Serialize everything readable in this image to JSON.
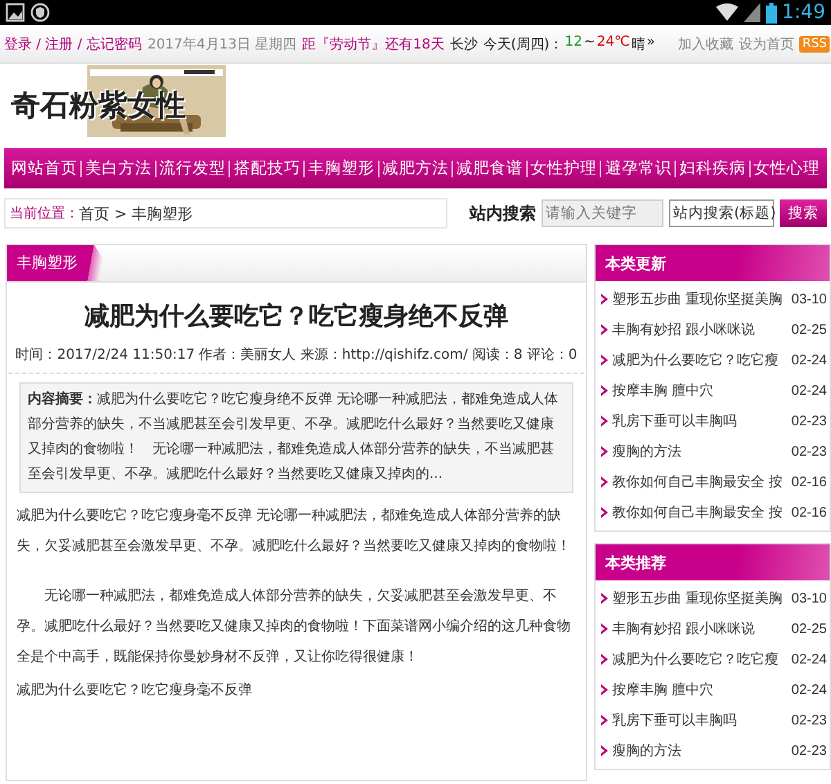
{
  "status_bar": {
    "time": "1:49"
  },
  "top_bar": {
    "account_links": "登录 / 注册 / 忘记密码",
    "date": "2017年4月13日 星期四",
    "countdown": "距『劳动节』还有18天",
    "city": "长沙",
    "weather_label": "今天(周四)：",
    "temp_low": "12",
    "temp_sep": "~",
    "temp_high": "24℃",
    "weather": "晴",
    "more": "»",
    "bookmark": "加入收藏",
    "homepage": "设为首页",
    "rss": "RSS"
  },
  "logo": {
    "text": "奇石粉紫女性"
  },
  "nav": [
    "网站首页",
    "美白方法",
    "流行发型",
    "搭配技巧",
    "丰胸塑形",
    "减肥方法",
    "减肥食谱",
    "女性护理",
    "避孕常识",
    "妇科疾病",
    "女性心理"
  ],
  "breadcrumb": {
    "label": "当前位置：",
    "path": "首页 > 丰胸塑形"
  },
  "search": {
    "label": "站内搜索",
    "placeholder": "请输入关键字",
    "scope": "站内搜索(标题)",
    "button": "搜索"
  },
  "article": {
    "section": "丰胸塑形",
    "title": "减肥为什么要吃它？吃它瘦身绝不反弹",
    "meta": "时间：2017/2/24 11:50:17  作者：美丽女人  来源：http://qishifz.com/  阅读：8  评论：0",
    "summary": "**内容摘要：**减肥为什么要吃它？吃它瘦身绝不反弹 无论哪一种减肥法，都难免造成人体部分营养的缺失，不当减肥甚至会引发早更、不孕。减肥吃什么最好？当然要吃又健康又掉肉的食物啦！　无论哪一种减肥法，都难免造成人体部分营养的缺失，不当减肥甚至会引发早更、不孕。减肥吃什么最好？当然要吃又健康又掉肉的...",
    "paragraphs": [
      "减肥为什么要吃它？吃它瘦身毫不反弹 无论哪一种减肥法，都难免造成人体部分营养的缺失，欠妥减肥甚至会激发早更、不孕。减肥吃什么最好？当然要吃又健康又掉肉的食物啦！",
      "　　无论哪一种减肥法，都难免造成人体部分营养的缺失，欠妥减肥甚至会激发早更、不孕。减肥吃什么最好？当然要吃又健康又掉肉的食物啦！下面菜谱网小编介绍的这几种食物全是个中高手，既能保持你曼妙身材不反弹，又让你吃得很健康！",
      "减肥为什么要吃它？吃它瘦身毫不反弹"
    ]
  },
  "sidebar": [
    {
      "title": "本类更新",
      "items": [
        {
          "text": "塑形五步曲 重现你坚挺美胸",
          "date": "03-10"
        },
        {
          "text": "丰胸有妙招 跟小咪咪说",
          "date": "02-25"
        },
        {
          "text": "减肥为什么要吃它？吃它瘦",
          "date": "02-24"
        },
        {
          "text": "按摩丰胸 膻中穴",
          "date": "02-24"
        },
        {
          "text": "乳房下垂可以丰胸吗",
          "date": "02-23"
        },
        {
          "text": "瘦胸的方法",
          "date": "02-23"
        },
        {
          "text": "教你如何自己丰胸最安全 按",
          "date": "02-16"
        },
        {
          "text": "教你如何自己丰胸最安全 按",
          "date": "02-16"
        }
      ]
    },
    {
      "title": "本类推荐",
      "items": [
        {
          "text": "塑形五步曲 重现你坚挺美胸",
          "date": "03-10"
        },
        {
          "text": "丰胸有妙招 跟小咪咪说",
          "date": "02-25"
        },
        {
          "text": "减肥为什么要吃它？吃它瘦",
          "date": "02-24"
        },
        {
          "text": "按摩丰胸 膻中穴",
          "date": "02-24"
        },
        {
          "text": "乳房下垂可以丰胸吗",
          "date": "02-23"
        },
        {
          "text": "瘦胸的方法",
          "date": "02-23"
        }
      ]
    }
  ]
}
